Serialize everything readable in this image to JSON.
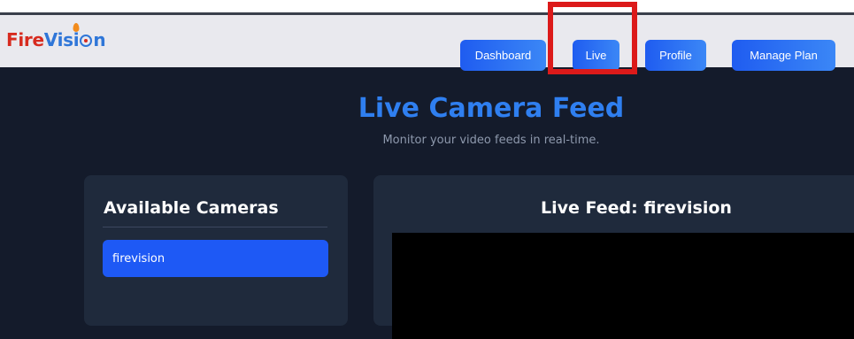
{
  "brand": {
    "fire": "Fire",
    "vision_pre": "Vis",
    "vision_i": "i",
    "vision_post": "n"
  },
  "nav": {
    "dashboard": "Dashboard",
    "live": "Live",
    "profile": "Profile",
    "manage_plan": "Manage Plan"
  },
  "page": {
    "title": "Live Camera Feed",
    "subtitle": "Monitor your video feeds in real-time."
  },
  "cameras": {
    "title": "Available Cameras",
    "items": [
      "firevision"
    ]
  },
  "feed": {
    "title": "Live Feed: firevision"
  },
  "colors": {
    "accent": "#2f7ff0",
    "button": "#1f5cf0",
    "highlight": "#dc1a1a",
    "background": "#141b2b",
    "panel": "#1f2a3c"
  },
  "icons": {
    "logo": "firevision-logo"
  }
}
